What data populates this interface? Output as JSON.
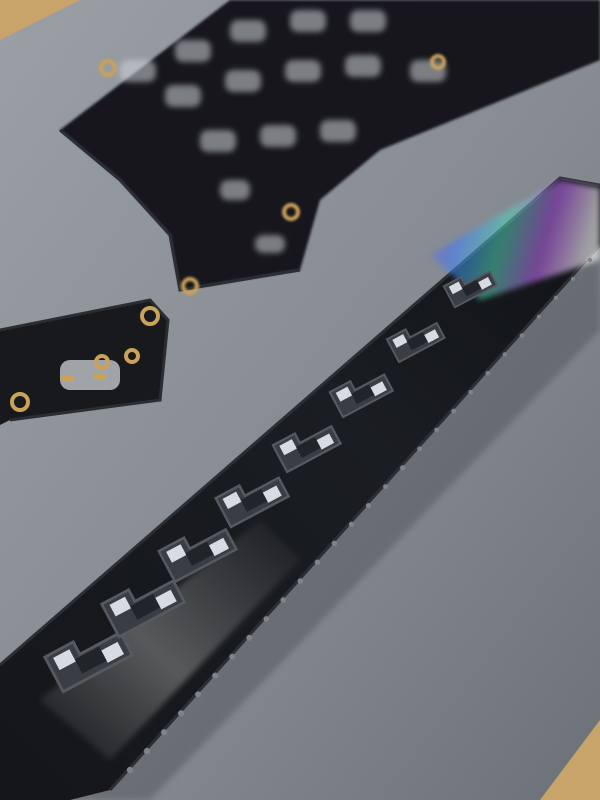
{
  "scene": {
    "subject": "photo",
    "colors": {
      "mat": "#8a8f96",
      "mat_shadow": "#6f747b",
      "wood": "#c9a46a",
      "pcb": "#17191c",
      "pcb_edge": "#2a2d31",
      "gold_pad": "#caa25a",
      "tape": "#0f1113",
      "tape_edge": "#2b2e33",
      "pocket": "#3a3e44",
      "socket_metal": "#d8dbe0",
      "cover_film_glare": "#e8ecf2"
    },
    "carrier_tape": {
      "pocket_count": 8
    },
    "pcb_boards": [
      {
        "label": "keyboard-pcb-large"
      },
      {
        "label": "keyboard-pcb-small"
      }
    ]
  }
}
